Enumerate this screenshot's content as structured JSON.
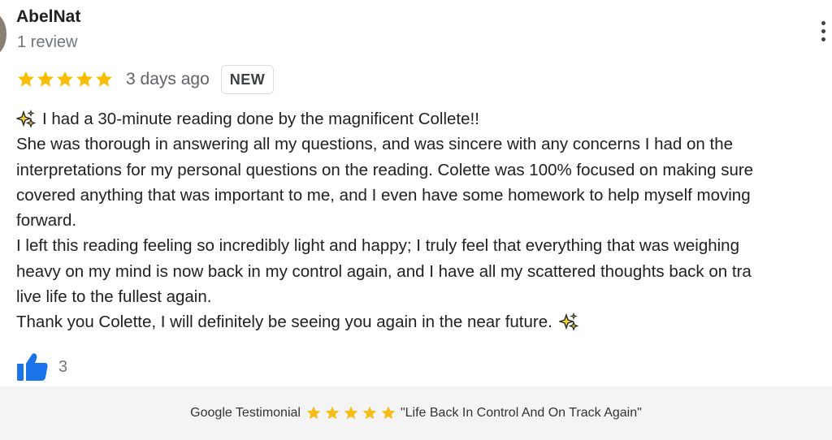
{
  "review": {
    "reviewer_name": "AbelNat",
    "review_count": "1 review",
    "rating": 5,
    "date": "3 days ago",
    "badge": "NEW",
    "star_color": "#fbbc04",
    "lines": [
      "I had a 30-minute reading done by the magnificent Collete!!",
      "She was thorough in answering all my questions, and was sincere with any concerns I had on the",
      "interpretations for my personal questions on the reading. Colette was 100% focused on making sure",
      "covered anything that was important to me, and I even have some homework to help myself moving",
      "forward.",
      "I left this reading feeling so incredibly light and happy; I truly feel that everything that was weighing",
      "heavy on my mind is now back in my control again, and I have all my scattered thoughts back on tra",
      "live life to the fullest again.",
      "Thank you Colette, I will definitely be seeing you again in the near future."
    ],
    "like_count": "3",
    "like_icon_color": "#1a73e8"
  },
  "footer": {
    "label": "Google Testimonial",
    "rating": 5,
    "star_color": "#f6bd16",
    "quote": "\"Life Back In Control And On Track Again\""
  }
}
